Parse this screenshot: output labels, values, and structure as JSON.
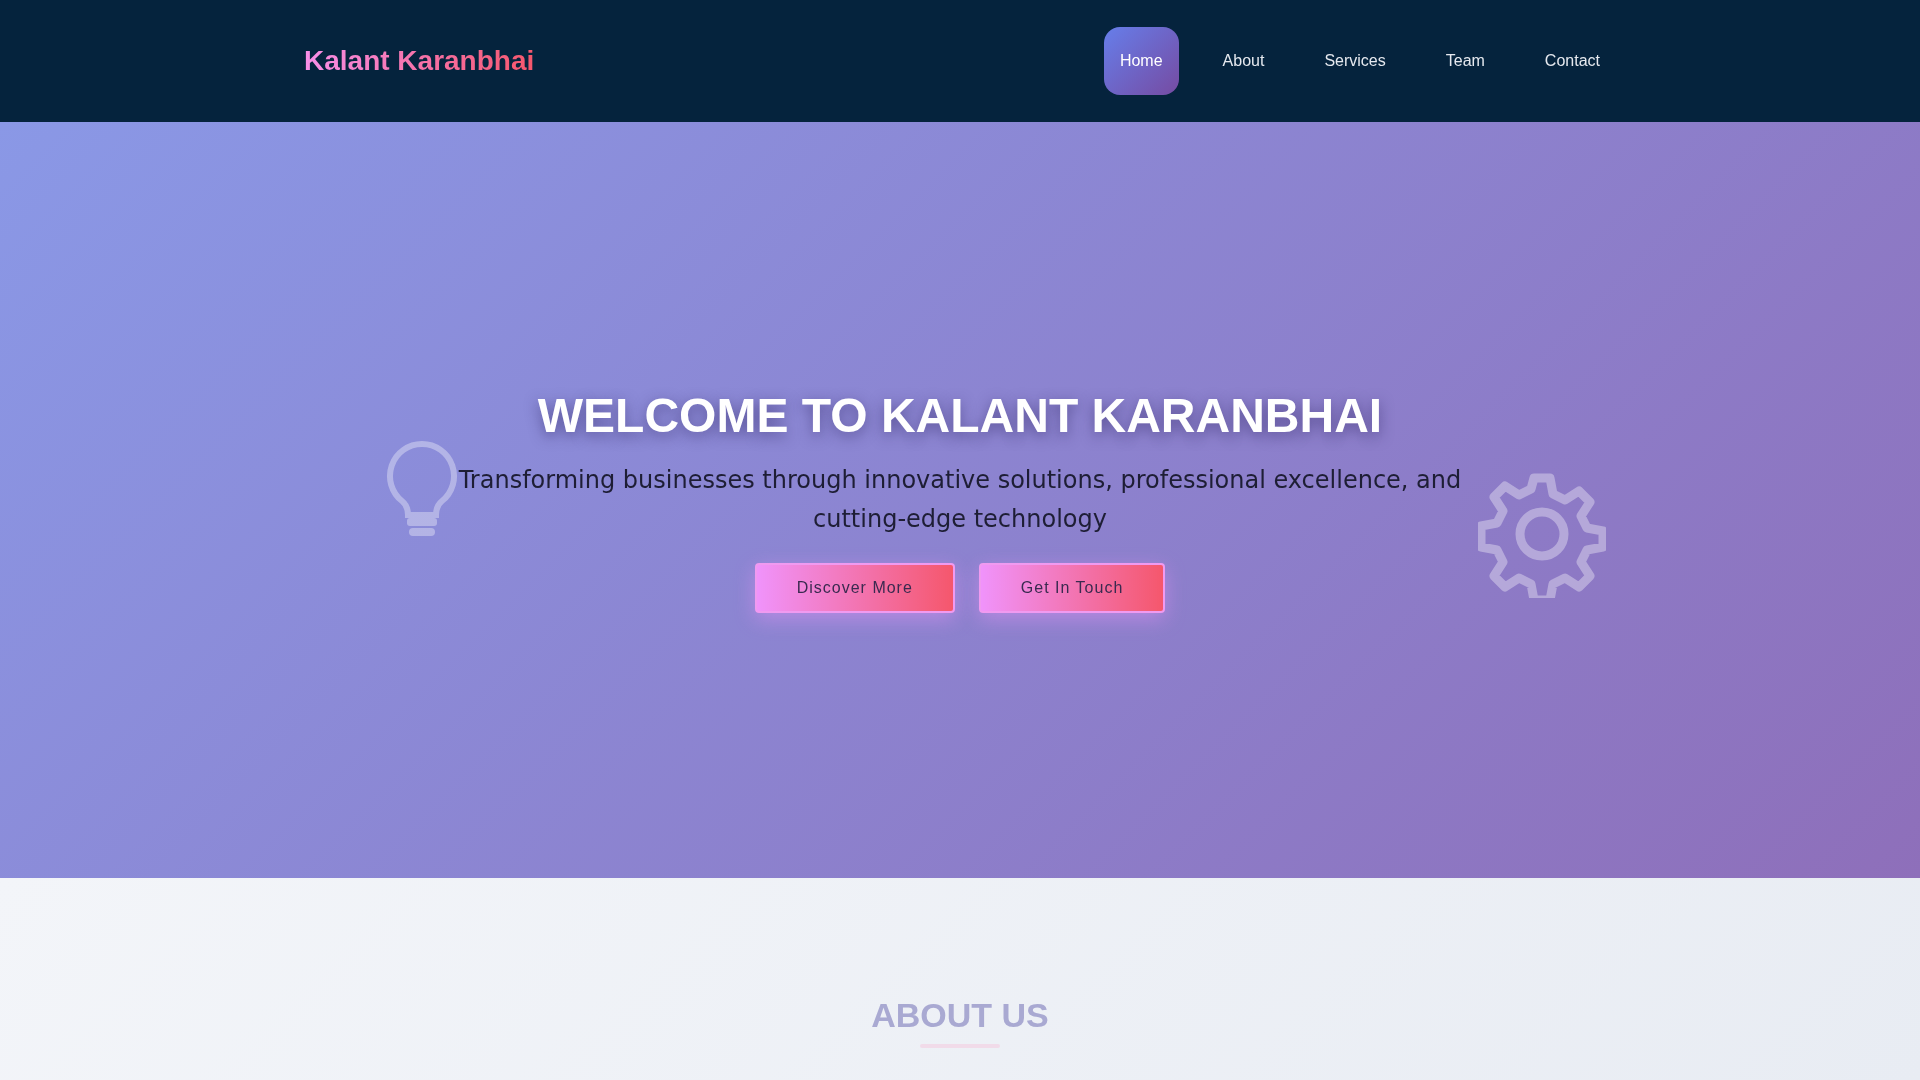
{
  "brand": "Kalant Karanbhai",
  "nav": [
    {
      "label": "Home",
      "selected": true
    },
    {
      "label": "About",
      "selected": false
    },
    {
      "label": "Services",
      "selected": false
    },
    {
      "label": "Team",
      "selected": false
    },
    {
      "label": "Contact",
      "selected": false
    }
  ],
  "hero": {
    "title": "WELCOME TO KALANT KARANBHAI",
    "subtitle": "Transforming businesses through innovative solutions, professional excellence, and cutting-edge technology",
    "buttons": [
      "Discover More",
      "Get In Touch"
    ]
  },
  "about": {
    "heading": "ABOUT US"
  }
}
